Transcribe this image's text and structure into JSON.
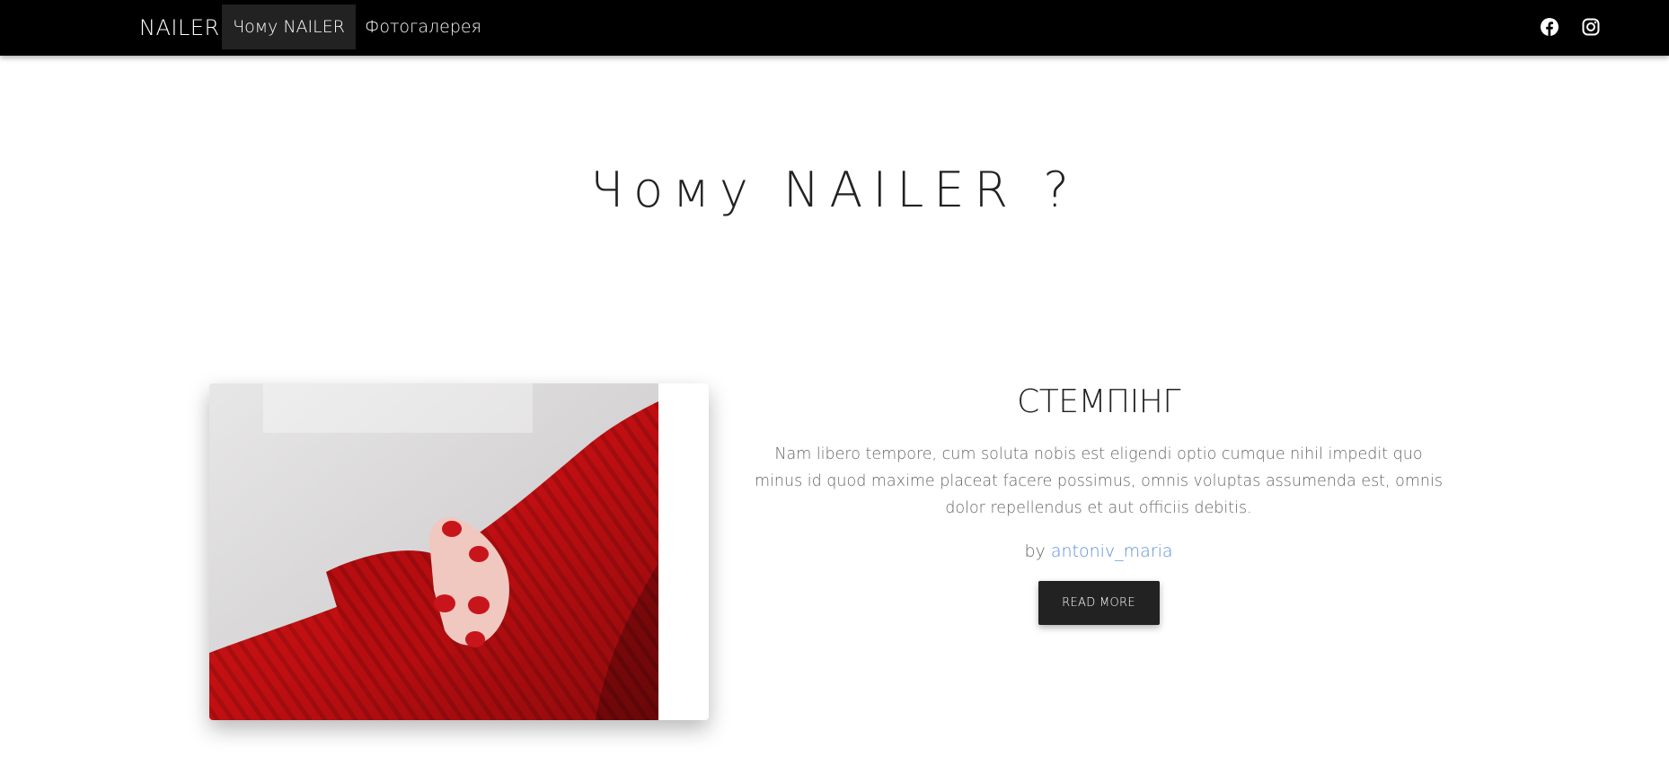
{
  "navbar": {
    "brand": "NAILER",
    "links": [
      {
        "label": "Чому NAILER ?",
        "active": true
      },
      {
        "label": "Фотогалерея",
        "active": false
      }
    ],
    "social": [
      {
        "icon": "facebook-icon"
      },
      {
        "icon": "instagram-icon"
      }
    ]
  },
  "main": {
    "section_title": "Чому NAILER ?",
    "article": {
      "title": "СТЕМПІНГ",
      "text": "Nam libero tempore, cum soluta nobis est eligendi optio cumque nihil impedit quo minus id quod maxime placeat facere possimus, omnis voluptas assumenda est, omnis dolor repellendus et aut officiis debitis.",
      "byline_prefix": "by",
      "author": "antoniv_maria",
      "button_label": "READ MORE"
    }
  },
  "colors": {
    "navbar_bg": "#000000",
    "active_link_bg": "#222222",
    "author_link": "#5b8ed6",
    "button_bg": "#222222"
  }
}
